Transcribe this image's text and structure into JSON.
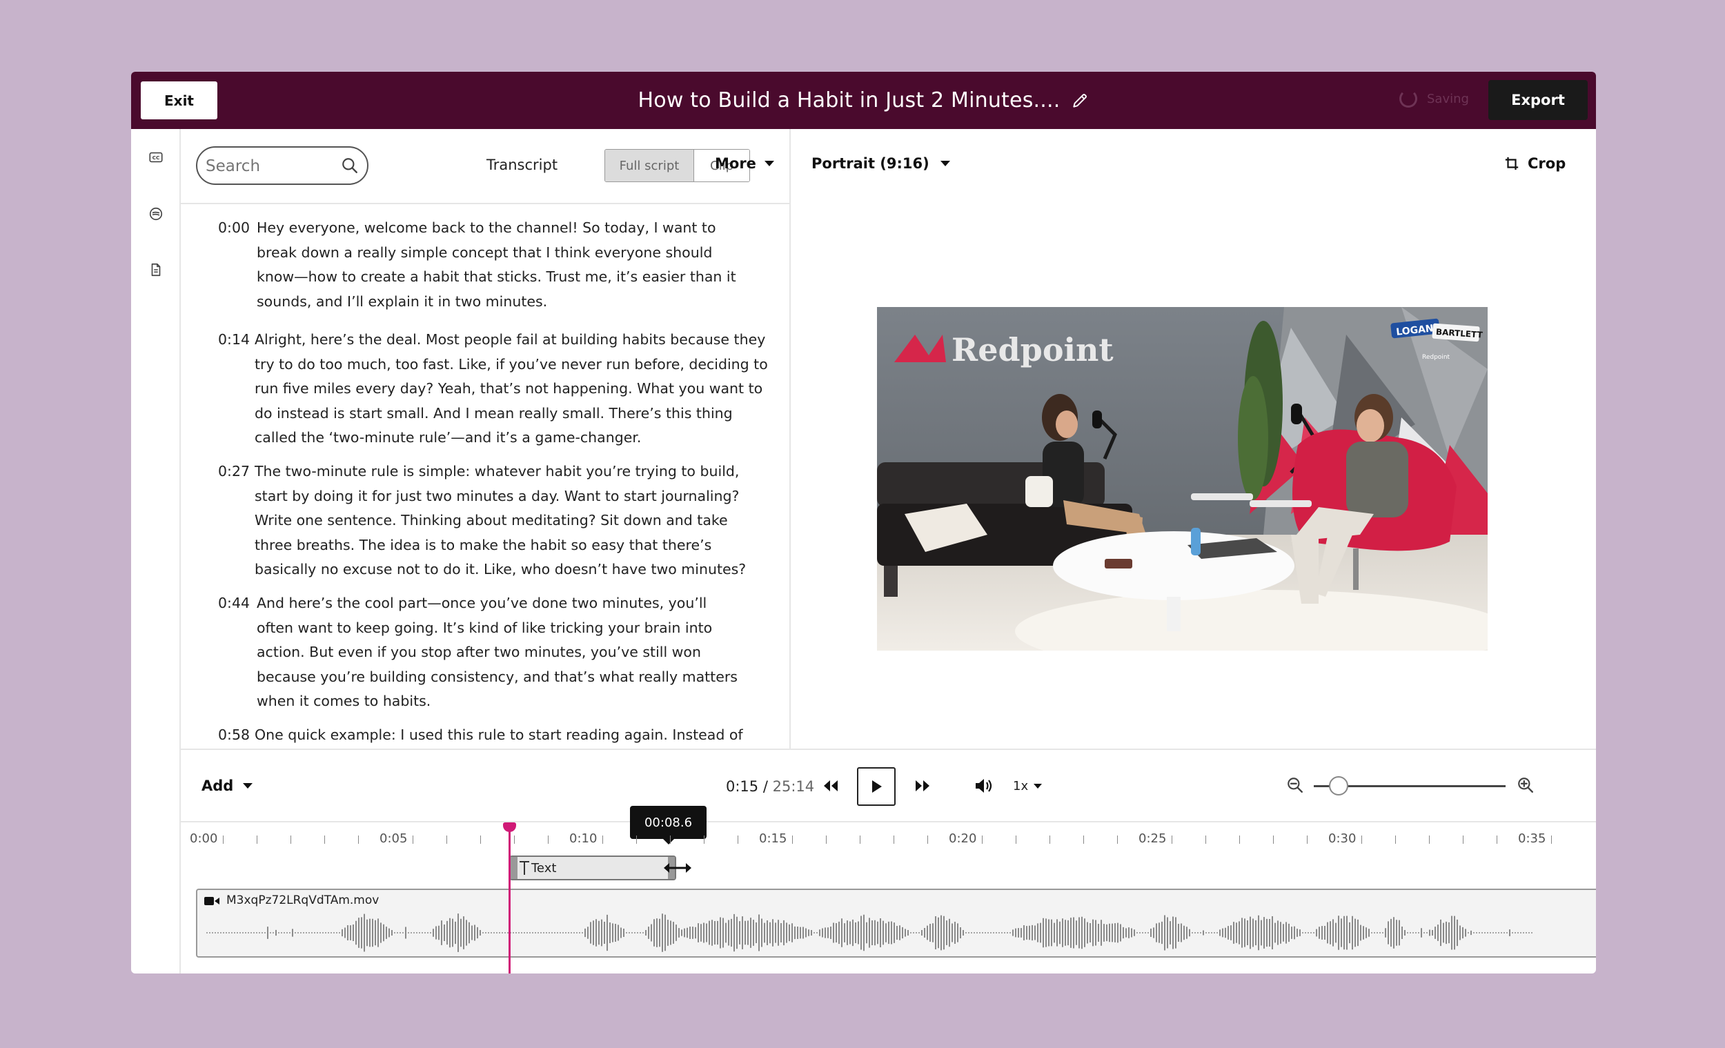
{
  "header": {
    "exit_label": "Exit",
    "title": "How to Build a Habit in Just 2 Minutes....",
    "saving_label": "Saving",
    "export_label": "Export"
  },
  "rail": {
    "icons": [
      "cc-icon",
      "sticker-icon",
      "document-icon"
    ]
  },
  "transcript_panel": {
    "search_placeholder": "Search",
    "transcript_label": "Transcript",
    "mode_full": "Full script",
    "mode_clip": "Clip",
    "more_label": "More",
    "paragraphs": [
      {
        "time": "0:00",
        "text": "Hey everyone, welcome back to the channel! So today, I want to break down a really simple concept that I think everyone should know—how to create a habit that sticks. Trust me, it’s easier than it sounds, and I’ll explain it in two minutes."
      },
      {
        "time": "0:14",
        "text": "Alright, here’s the deal. Most people fail at building habits because they try to do too much, too fast. Like, if you’ve never run before, deciding to run five miles every day? Yeah, that’s not happening. What you want to do instead is start small. And I mean really small. There’s this thing called the ‘two-minute rule’—and it’s a game-changer."
      },
      {
        "time": "0:27",
        "text": "The two-minute rule is simple: whatever habit you’re trying to build, start by doing it for just two minutes a day. Want to start journaling? Write one sentence. Thinking about meditating? Sit down and take three breaths. The idea is to make the habit so easy that there’s basically no excuse not to do it. Like, who doesn’t have two minutes?"
      },
      {
        "time": "0:44",
        "text": "And here’s the cool part—once you’ve done two minutes, you’ll often want to keep going. It’s kind of like tricking your brain into action. But even if you stop after two minutes, you’ve still won because you’re building consistency, and that’s what really matters when it comes to habits."
      },
      {
        "time": "0:58",
        "text": "One quick example: I used this rule to start reading again. Instead of"
      }
    ]
  },
  "preview": {
    "aspect_label": "Portrait (9:16)",
    "crop_label": "Crop",
    "video": {
      "wall_logo": "Redpoint",
      "show_logo_top": "LOGAN",
      "show_logo_bottom": "BARTLETT",
      "show_logo_sub": "Redpoint"
    }
  },
  "controls": {
    "add_label": "Add",
    "current_time": "0:15",
    "separator": "/",
    "duration": "25:14",
    "speed": "1x",
    "zoom_level": 0.13
  },
  "timeline": {
    "tooltip": "00:08.6",
    "ticks": [
      "0:00",
      "0:05",
      "0:10",
      "0:15",
      "0:20",
      "0:25",
      "0:30",
      "0:35"
    ],
    "text_clip_label": "Text",
    "video_clip_name": "M3xqPz72LRqVdTAm.mov"
  },
  "colors": {
    "header_bg": "#4a0a2d",
    "playhead": "#d01a77",
    "background": "#c7b3cb"
  }
}
